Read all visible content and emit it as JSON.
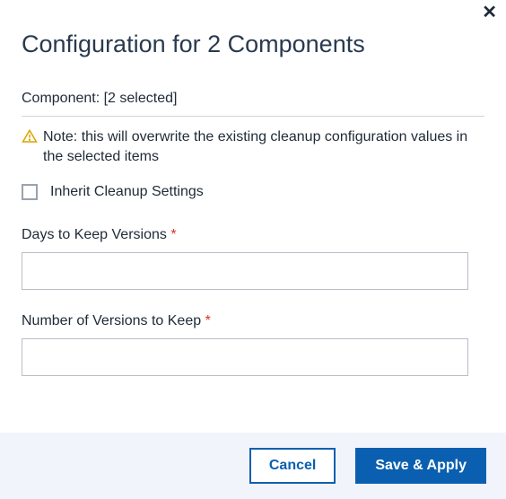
{
  "modal": {
    "title": "Configuration for 2 Components",
    "close_icon": "✕"
  },
  "component_line": {
    "prefix": "Component: ",
    "value": "[2 selected]"
  },
  "note": {
    "icon": "warning-triangle-icon",
    "text": "Note: this will overwrite the existing cleanup configuration values in the selected items"
  },
  "inherit": {
    "checked": false,
    "label": "Inherit Cleanup Settings"
  },
  "fields": {
    "days": {
      "label": "Days to Keep Versions",
      "required_marker": "*",
      "value": ""
    },
    "versions": {
      "label": "Number of Versions to Keep",
      "required_marker": "*",
      "value": ""
    }
  },
  "footer": {
    "cancel": "Cancel",
    "save": "Save & Apply"
  }
}
